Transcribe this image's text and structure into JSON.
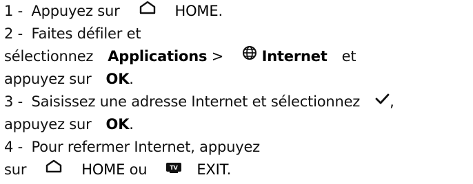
{
  "steps": [
    {
      "line1": {
        "number": "1 -",
        "text_a": "Appuyez sur",
        "icon": "home-icon",
        "key": "HOME",
        "text_b": "."
      }
    },
    {
      "line1": {
        "number": "2 -",
        "text_a": "Faites défiler et"
      },
      "line2": {
        "text_a": "sélectionnez",
        "menu": "Applications",
        "sep": ">",
        "icon": "globe-icon",
        "app": "Internet",
        "text_b": "et"
      },
      "line3": {
        "text_a": "appuyez sur",
        "key": "OK",
        "text_b": "."
      }
    },
    {
      "line1": {
        "number": "3 -",
        "text_a": "Saisissez une adresse Internet et sélectionnez",
        "icon": "checkmark-icon",
        "text_b": ","
      },
      "line2": {
        "text_a": "appuyez sur",
        "key": "OK",
        "text_b": "."
      }
    },
    {
      "line1": {
        "number": "4 -",
        "text_a": "Pour refermer Internet, appuyez"
      },
      "line2": {
        "text_a": "sur",
        "icon1": "home-icon",
        "key1": "HOME",
        "text_b": "ou",
        "icon2": "tv-icon",
        "key2": "EXIT",
        "text_c": "."
      }
    }
  ]
}
